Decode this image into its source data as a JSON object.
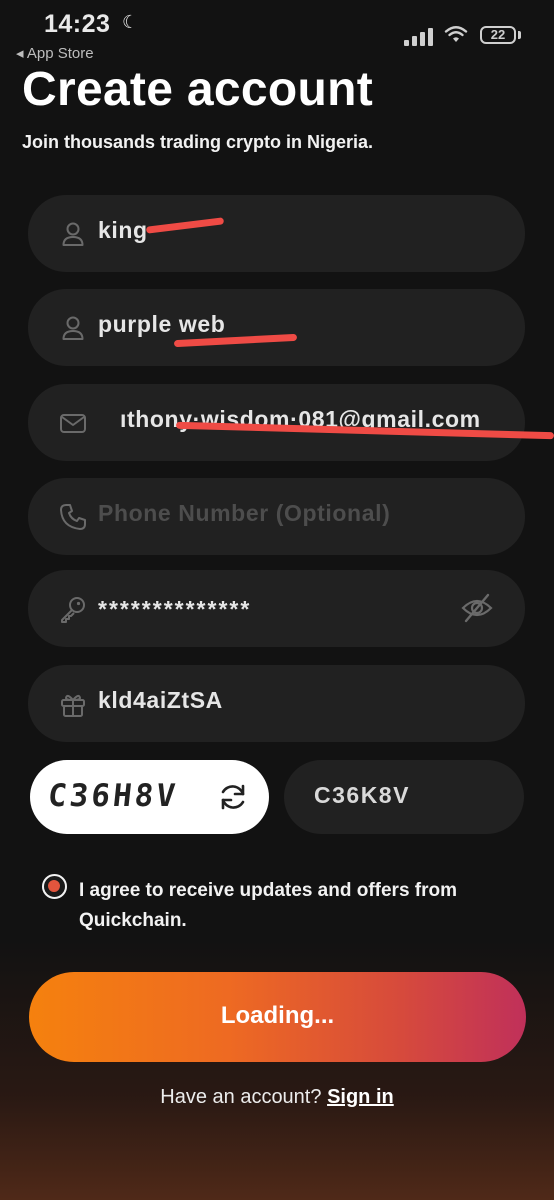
{
  "status_bar": {
    "time": "14:23",
    "back_label": "◂ App Store",
    "battery": "22"
  },
  "header": {
    "title": "Create account",
    "subtitle": "Join thousands trading crypto in Nigeria."
  },
  "form": {
    "first_name": {
      "value": "king",
      "icon": "person-icon"
    },
    "last_name": {
      "value": "purple web",
      "icon": "person-icon"
    },
    "email": {
      "value": "ıthony·wisdom·081@gmail.com",
      "icon": "envelope-icon"
    },
    "phone": {
      "placeholder": "Phone Number (Optional)",
      "icon": "phone-icon"
    },
    "password": {
      "value": "**************",
      "icon": "key-icon",
      "toggle_icon": "eye-off-icon"
    },
    "referral": {
      "value": "kld4aiZtSA",
      "icon": "gift-icon"
    },
    "captcha": {
      "image_text": "C36H8V",
      "input_value": "C36K8V"
    },
    "agree_text": "I agree to receive updates and offers from Quickchain.",
    "submit_label": "Loading..."
  },
  "footer": {
    "prompt": "Have an account?",
    "link": "Sign in"
  },
  "colors": {
    "accent_start": "#f5810e",
    "accent_end": "#c0305a",
    "redaction": "#ef4b45",
    "field_bg": "#212121"
  }
}
